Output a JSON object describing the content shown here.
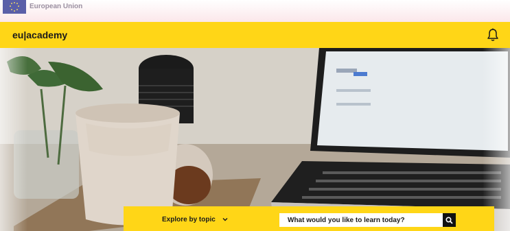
{
  "eu_bar": {
    "label": "European Union"
  },
  "header": {
    "brand": "eu|academy"
  },
  "search_bar": {
    "topic_label": "Explore by topic",
    "search_placeholder": "What would you like to learn today?"
  },
  "icons": {
    "notification": "bell-icon",
    "topic_toggle": "chevron-down-icon",
    "search": "search-icon",
    "flag": "eu-flag-icon"
  },
  "colors": {
    "accent": "#ffd617",
    "search_button": "#111111"
  }
}
